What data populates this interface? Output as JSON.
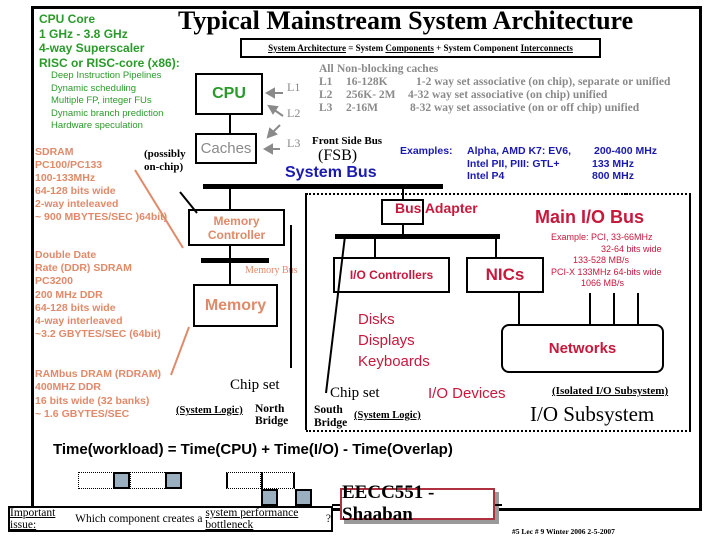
{
  "title": "Typical Mainstream System Architecture",
  "equation_box": {
    "part1": "System Architecture",
    "eq": " = ",
    "part2a": "System ",
    "part2b": "Components",
    "plus": " + ",
    "part3a": "System Component ",
    "part3b": "Interconnects"
  },
  "cpu_core": {
    "heading_lines": [
      "CPU Core",
      "1 GHz - 3.8 GHz",
      "4-way Superscaler",
      "RISC or RISC-core (x86):"
    ],
    "features": [
      "Deep Instruction Pipelines",
      "Dynamic scheduling",
      "Multiple FP, integer FUs",
      "Dynamic branch prediction",
      "Hardware speculation"
    ]
  },
  "blocks": {
    "cpu": "CPU",
    "caches": "Caches",
    "caches_note_line1": "(possibly",
    "caches_note_line2": "on-chip)",
    "memory_controller_line1": "Memory",
    "memory_controller_line2": "Controller",
    "memory": "Memory",
    "memory_bus": "Memory Bus",
    "io_controllers": "I/O Controllers",
    "nics": "NICs",
    "networks": "Networks",
    "bus_adapter": "Bus Adapter"
  },
  "cache_levels": {
    "arrow_labels": [
      "L1",
      "L2",
      "L3"
    ],
    "table": [
      {
        "level": "All",
        "size": "Non-blocking caches",
        "desc": ""
      },
      {
        "level": "L1",
        "size": "16-128K",
        "desc": "1-2 way set associative (on chip), separate or unified"
      },
      {
        "level": "L2",
        "size": "256K- 2M",
        "desc": "4-32 way set associative  (on chip) unified"
      },
      {
        "level": "L3",
        "size": "2-16M",
        "desc": "8-32  way set associative  (on or off chip) unified"
      }
    ]
  },
  "fsb": {
    "line1": "Front Side Bus",
    "line2": "(FSB)",
    "system_bus": "System Bus",
    "examples_label": "Examples:",
    "examples": [
      {
        "name": "Alpha, AMD K7:  EV6,",
        "speed": "200-400 MHz"
      },
      {
        "name": "Intel  PII, PIII:  GTL+",
        "speed": "133 MHz"
      },
      {
        "name": "Intel P4",
        "speed": "800 MHz"
      }
    ]
  },
  "sdram": [
    "SDRAM",
    "PC100/PC133",
    "100-133MHz",
    "64-128 bits wide",
    "2-way inteleaved",
    "~ 900 MBYTES/SEC )64bit)"
  ],
  "ddr": [
    "Double Date",
    "Rate  (DDR) SDRAM",
    "PC3200",
    "200 MHz  DDR",
    "64-128 bits wide",
    "4-way interleaved",
    "~3.2 GBYTES/SEC (64bit)"
  ],
  "rdram": [
    "RAMbus DRAM (RDRAM)",
    "400MHZ DDR",
    "16 bits wide (32 banks)",
    "~ 1.6 GBYTES/SEC"
  ],
  "main_io_bus": {
    "title": "Main I/O Bus",
    "lines": [
      "Example:  PCI,  33-66MHz",
      "32-64 bits wide",
      "133-528 MB/s",
      "PCI-X  133MHz  64-bits wide",
      "1066 MB/s"
    ]
  },
  "io_devices": {
    "list": [
      "Disks",
      "Displays",
      "Keyboards"
    ],
    "label": "I/O Devices"
  },
  "chipset": {
    "north_label": "Chip set",
    "north_logic": "(System Logic)",
    "north_line1": "North",
    "north_line2": "Bridge",
    "south_label": "Chip set",
    "south_logic": "(System Logic)",
    "south_line1": "South",
    "south_line2": "Bridge"
  },
  "io_subsystem": {
    "isolated": "(Isolated I/O Subsystem)",
    "title": "I/O Subsystem"
  },
  "formula": "Time(workload) = Time(CPU) + Time(I/O) - Time(Overlap)",
  "issue": {
    "label": "Important issue:",
    "text1": " Which component creates a ",
    "text2": "system performance bottleneck",
    "text3": "?"
  },
  "footer": {
    "course": "EECC551 - Shaaban",
    "meta": "#5   Lec # 9   Winter 2006  2-5-2007"
  },
  "colors": {
    "green": "#2a9a2a",
    "salmon": "#e08a6a",
    "crimson": "#c8183c",
    "navy": "#1a1ab0",
    "gray": "#8a8a8a",
    "timeline_fill": "#9ab0c0"
  }
}
